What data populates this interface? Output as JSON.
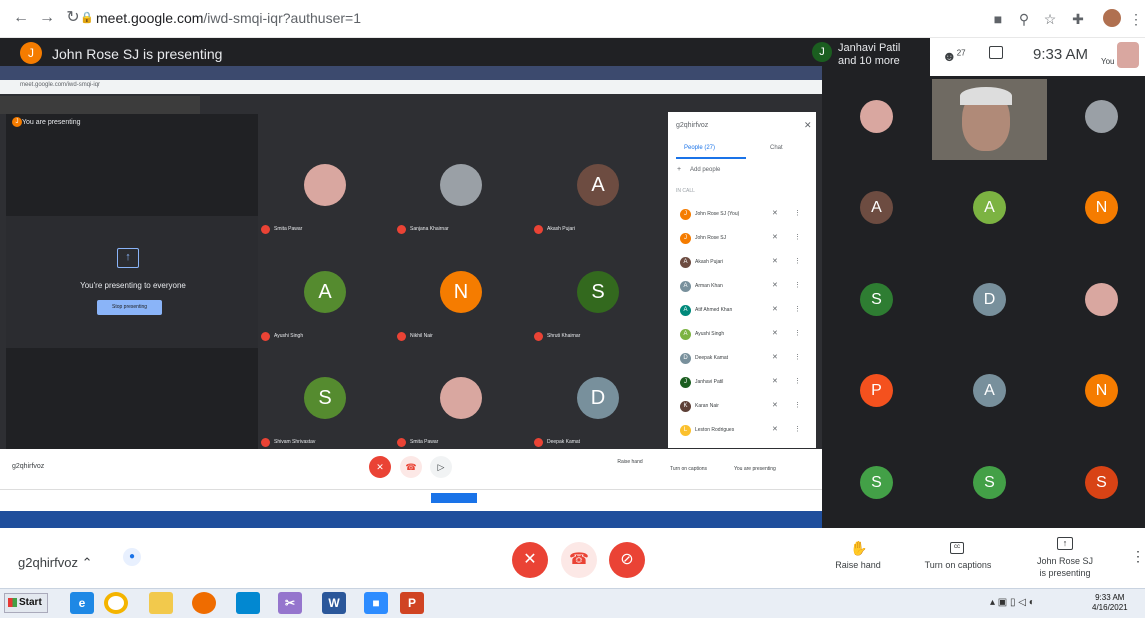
{
  "browser": {
    "url_domain": "meet.google.com",
    "url_path": "/iwd-smqi-iqr?authuser=1",
    "back_icon": "arrow-left-icon",
    "forward_icon": "arrow-right-icon",
    "reload_icon": "reload-icon"
  },
  "header": {
    "presenter_initial": "J",
    "presenter_title": "John Rose SJ is presenting",
    "attendee_initial": "J",
    "attendee_line1": "Janhavi Patil",
    "attendee_line2": "and 10 more",
    "people_count": "27",
    "time": "9:33 AM",
    "you_label": "You"
  },
  "inner": {
    "url": "meet.google.com/iwd-smqi-iqr",
    "you_are_presenting": "You are presenting",
    "presenting_text": "You're presenting to everyone",
    "stop_button": "Stop presenting",
    "meeting_code": "g2qhirfvoz",
    "tiles": [
      {
        "initial": "",
        "name": "Smita Pawar",
        "color": "#d9a7a0"
      },
      {
        "initial": "",
        "name": "Sanjana Khairnar",
        "color": "#9aa0a6"
      },
      {
        "initial": "A",
        "name": "Akash Pujari",
        "color": "#6d4c41"
      },
      {
        "initial": "A",
        "name": "Ayushi Singh",
        "color": "#558b2f"
      },
      {
        "initial": "N",
        "name": "Nikhil Nair",
        "color": "#f57c00"
      },
      {
        "initial": "S",
        "name": "Shruti Khairnar",
        "color": "#33691e"
      },
      {
        "initial": "S",
        "name": "Shivam Shrivastav",
        "color": "#558b2f"
      },
      {
        "initial": "",
        "name": "Smita Pawar",
        "color": "#d9a7a0"
      },
      {
        "initial": "D",
        "name": "Deepak Kamat",
        "color": "#78909c"
      }
    ],
    "people_panel": {
      "code": "g2qhirfvoz",
      "tab_people": "People (27)",
      "tab_chat": "Chat",
      "add_people": "Add people",
      "in_call": "IN CALL",
      "rows": [
        {
          "initial": "J",
          "name": "John Rose SJ (You)",
          "color": "#f57c00"
        },
        {
          "initial": "J",
          "name": "John Rose SJ",
          "color": "#f57c00"
        },
        {
          "initial": "A",
          "name": "Akash Pujari",
          "color": "#6d4c41"
        },
        {
          "initial": "A",
          "name": "Arman Khan",
          "color": "#78909c"
        },
        {
          "initial": "A",
          "name": "Atif Ahmed Khan",
          "color": "#00897b"
        },
        {
          "initial": "A",
          "name": "Ayushi Singh",
          "color": "#7cb342"
        },
        {
          "initial": "D",
          "name": "Deepak Kamat",
          "color": "#78909c"
        },
        {
          "initial": "J",
          "name": "Janhavi Patil",
          "color": "#1b5e20"
        },
        {
          "initial": "K",
          "name": "Karan Nair",
          "color": "#5d4037"
        },
        {
          "initial": "L",
          "name": "Leston Rodrigues",
          "color": "#fbc02d"
        }
      ]
    },
    "bottom": {
      "raise_hand": "Raise hand",
      "captions": "Turn on captions",
      "presenting": "You are presenting"
    }
  },
  "grid": [
    {
      "initial": "",
      "color": "#d9a7a0",
      "photo": true
    },
    {
      "initial": "",
      "color": "#8a8a8a",
      "photo": true
    },
    {
      "initial": "",
      "color": "#9aa0a6",
      "photo": true
    },
    {
      "initial": "A",
      "color": "#6d4c41"
    },
    {
      "initial": "A",
      "color": "#7cb342"
    },
    {
      "initial": "N",
      "color": "#f57c00"
    },
    {
      "initial": "S",
      "color": "#2e7d32"
    },
    {
      "initial": "D",
      "color": "#78909c"
    },
    {
      "initial": "",
      "color": "#d9a7a0",
      "photo": true
    },
    {
      "initial": "P",
      "color": "#f4511e"
    },
    {
      "initial": "A",
      "color": "#78909c"
    },
    {
      "initial": "N",
      "color": "#f57c00"
    },
    {
      "initial": "S",
      "color": "#43a047"
    },
    {
      "initial": "S",
      "color": "#43a047"
    },
    {
      "initial": "S",
      "color": "#d84315"
    }
  ],
  "bottom": {
    "meeting_code": "g2qhirfvoz",
    "raise_hand": "Raise hand",
    "captions": "Turn on captions",
    "presenter_line1": "John Rose SJ",
    "presenter_line2": "is presenting"
  },
  "taskbar": {
    "start": "Start",
    "time": "9:33 AM",
    "date": "4/16/2021"
  }
}
